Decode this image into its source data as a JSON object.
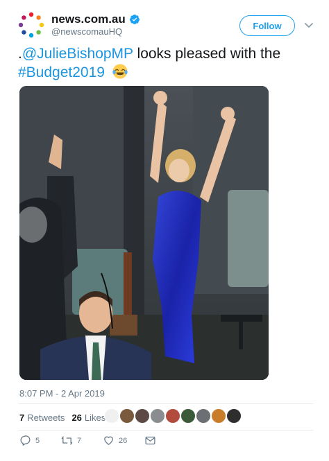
{
  "account": {
    "name": "news.com.au",
    "handle": "@newscomauHQ",
    "follow_label": "Follow"
  },
  "tweet": {
    "prefix": ".",
    "mention": "@JulieBishopMP",
    "middle_text": " looks pleased with the",
    "hashtag": "#Budget2019",
    "emoji": "face-with-tears-of-joy"
  },
  "meta": {
    "timestamp": "8:07 PM - 2 Apr 2019",
    "retweets_count": "7",
    "retweets_label": "Retweets",
    "likes_count": "26",
    "likes_label": "Likes"
  },
  "actions": {
    "replies": "5",
    "retweets": "7",
    "likes": "26"
  },
  "colors": {
    "accent": "#1da1f2",
    "link": "#1b95e0",
    "muted": "#657786"
  }
}
